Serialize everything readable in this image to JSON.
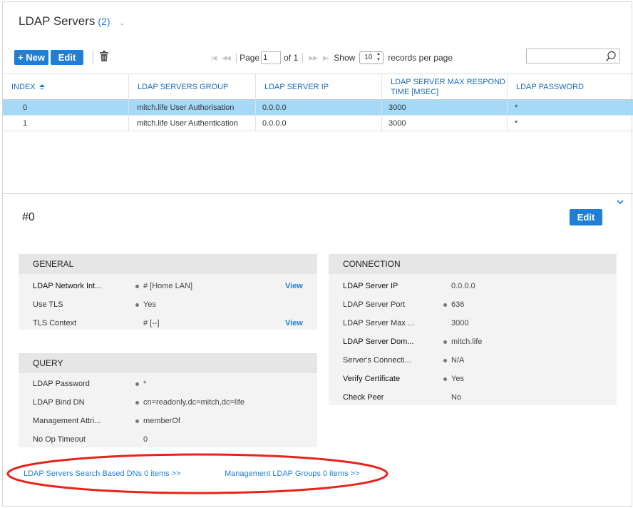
{
  "header": {
    "title": "LDAP Servers",
    "count": "(2)",
    "dot": "."
  },
  "toolbar": {
    "new_label": "+ New",
    "edit_label": "Edit",
    "page_label": "Page",
    "page_value": "1",
    "of_label": "of 1",
    "show_label": "Show",
    "records_value": "10",
    "records_label": "records per page",
    "search_placeholder": ""
  },
  "table": {
    "columns": [
      "INDEX",
      "LDAP SERVERS GROUP",
      "LDAP SERVER IP",
      "LDAP SERVER MAX RESPOND TIME [MSEC]",
      "LDAP PASSWORD"
    ],
    "rows": [
      [
        "0",
        "mitch.life User Authorisation",
        "0.0.0.0",
        "3000",
        "*"
      ],
      [
        "1",
        "mitch.life User Authentication",
        "0.0.0.0",
        "3000",
        "*"
      ]
    ],
    "selected_row": 0
  },
  "detail": {
    "title": "#0",
    "edit_label": "Edit",
    "general": {
      "header": "GENERAL",
      "fields": [
        {
          "label": "LDAP Network Int...",
          "value": "# [Home LAN]",
          "link": "View"
        },
        {
          "label": "Use TLS",
          "value": "Yes"
        },
        {
          "label": "TLS Context",
          "value": "# [--]",
          "link": "View"
        }
      ]
    },
    "query": {
      "header": "QUERY",
      "fields": [
        {
          "label": "LDAP Password",
          "value": "*"
        },
        {
          "label": "LDAP Bind DN",
          "value": "cn=readonly,dc=mitch,dc=life"
        },
        {
          "label": "Management Attri...",
          "value": "memberOf"
        },
        {
          "label": "No Op Timeout",
          "value": "0"
        }
      ]
    },
    "connection": {
      "header": "CONNECTION",
      "fields": [
        {
          "label": "LDAP Server IP",
          "value": "0.0.0.0"
        },
        {
          "label": "LDAP Server Port",
          "value": "636"
        },
        {
          "label": "LDAP Server Max ...",
          "value": "3000"
        },
        {
          "label": "LDAP Server Dom...",
          "value": "mitch.life"
        },
        {
          "label": "Server's Connecti...",
          "value": "N/A"
        },
        {
          "label": "Verify Certificate",
          "value": "Yes"
        },
        {
          "label": "Check Peer",
          "value": "No"
        }
      ]
    }
  },
  "footer": {
    "search_dns_link": "LDAP Servers Search Based DNs 0 items >>",
    "mgmt_groups_link": "Management LDAP Groups 0 items >>"
  },
  "colors": {
    "accent": "#1f7fd4",
    "selected_row": "#a6d9f7",
    "annotation": "#e8231a"
  }
}
